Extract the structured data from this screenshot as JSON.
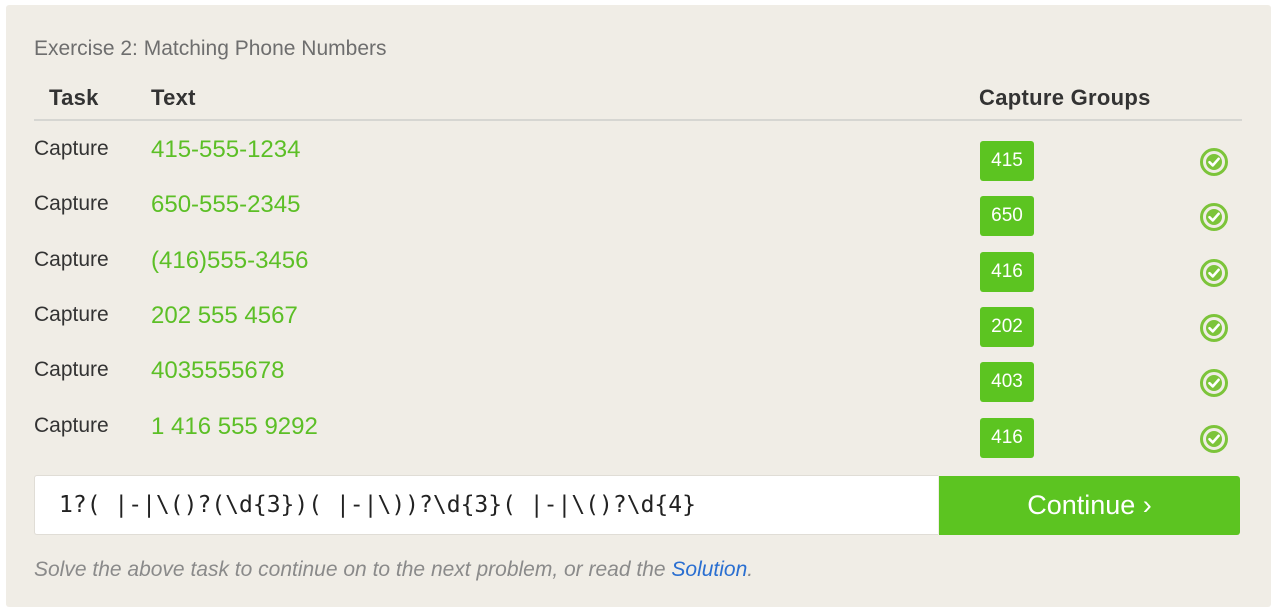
{
  "exercise": {
    "title": "Exercise 2: Matching Phone Numbers"
  },
  "table": {
    "headers": {
      "task": "Task",
      "text": "Text",
      "capture_groups": "Capture Groups"
    },
    "rows": [
      {
        "task": "Capture",
        "text": "415-555-1234",
        "group": "415",
        "status": "passed"
      },
      {
        "task": "Capture",
        "text": "650-555-2345",
        "group": "650",
        "status": "passed"
      },
      {
        "task": "Capture",
        "text": "(416)555-3456",
        "group": "416",
        "status": "passed"
      },
      {
        "task": "Capture",
        "text": "202 555 4567",
        "group": "202",
        "status": "passed"
      },
      {
        "task": "Capture",
        "text": "4035555678",
        "group": "403",
        "status": "passed"
      },
      {
        "task": "Capture",
        "text": "1 416 555 9292",
        "group": "416",
        "status": "passed"
      }
    ]
  },
  "regex_input": {
    "value": "1?( |-|\\()?(\\d{3})( |-|\\))?\\d{3}( |-|\\()?\\d{4}"
  },
  "continue_button": {
    "label": "Continue ›"
  },
  "footer": {
    "text_before": "Solve the above task to continue on to the next problem, or read the ",
    "link_label": "Solution",
    "text_after": "."
  },
  "colors": {
    "panel_background": "#f0ede6",
    "accent_green": "#5cc421",
    "text_green": "#5cbf26",
    "link_blue": "#2a6fd1"
  },
  "icons": {
    "row_status": "check-circle-icon"
  }
}
